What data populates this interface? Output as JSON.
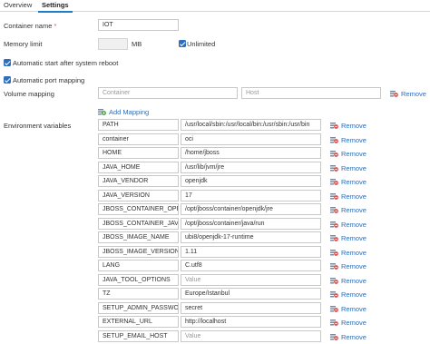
{
  "tabs": [
    "Overview",
    "Settings"
  ],
  "container_name": {
    "label": "Container name",
    "required_mark": "*",
    "value": "IOT"
  },
  "memory_limit": {
    "label": "Memory limit",
    "value": "",
    "unit": "MB",
    "unlimited_label": "Unlimited",
    "unlimited_checked": true
  },
  "auto_start": {
    "label": "Automatic start after system reboot",
    "checked": true
  },
  "auto_port": {
    "label": "Automatic port mapping",
    "checked": true
  },
  "volume": {
    "label": "Volume mapping",
    "container_placeholder": "Container",
    "host_placeholder": "Host",
    "remove_label": "Remove",
    "add_label": "Add Mapping"
  },
  "env": {
    "label": "Environment variables",
    "remove_label": "Remove",
    "value_placeholder": "Value",
    "rows": [
      {
        "key": "PATH",
        "value": "/usr/local/sbin:/usr/local/bin:/usr/sbin:/usr/bin"
      },
      {
        "key": "container",
        "value": "oci"
      },
      {
        "key": "HOME",
        "value": "/home/jboss"
      },
      {
        "key": "JAVA_HOME",
        "value": "/usr/lib/jvm/jre"
      },
      {
        "key": "JAVA_VENDOR",
        "value": "openjdk"
      },
      {
        "key": "JAVA_VERSION",
        "value": "17"
      },
      {
        "key": "JBOSS_CONTAINER_OPENJDK_JDK_MODULE",
        "value": "/opt/jboss/container/openjdk/jre"
      },
      {
        "key": "JBOSS_CONTAINER_JAVA_RUN_MODULE",
        "value": "/opt/jboss/container/java/run"
      },
      {
        "key": "JBOSS_IMAGE_NAME",
        "value": "ubi8/openjdk-17-runtime"
      },
      {
        "key": "JBOSS_IMAGE_VERSION",
        "value": "1.11"
      },
      {
        "key": "LANG",
        "value": "C.utf8"
      },
      {
        "key": "JAVA_TOOL_OPTIONS",
        "value": ""
      },
      {
        "key": "TZ",
        "value": "Europe/Istanbul"
      },
      {
        "key": "SETUP_ADMIN_PASSWORD",
        "value": "secret"
      },
      {
        "key": "EXTERNAL_URL",
        "value": "http://localhost"
      },
      {
        "key": "SETUP_EMAIL_HOST",
        "value": ""
      }
    ]
  },
  "colors": {
    "link": "#2a6ebb",
    "checkbox": "#2c6fbf",
    "remove_icon": "#d9534f",
    "add_icon": "#3c9a3c"
  },
  "icons": {
    "remove": "remove-row-icon",
    "add": "add-row-icon"
  }
}
